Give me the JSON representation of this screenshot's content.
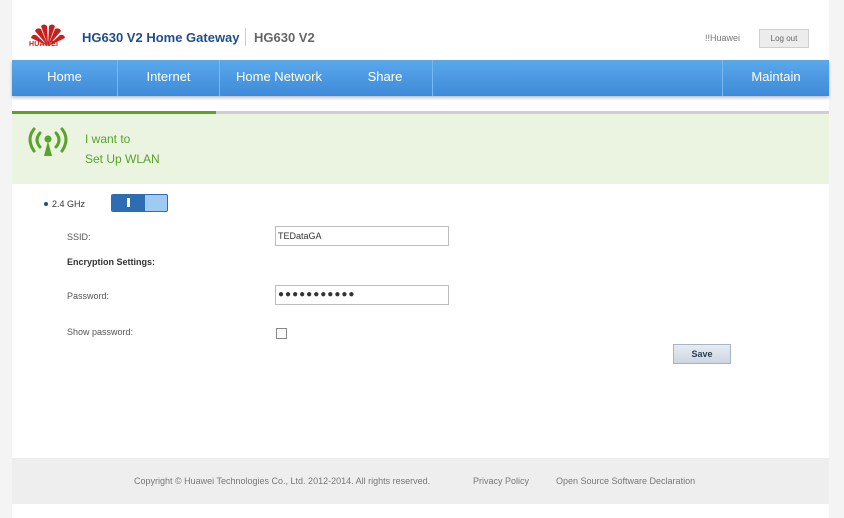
{
  "header": {
    "brand": "HUAWEI",
    "product_title": "HG630 V2 Home Gateway",
    "product_sub": "HG630 V2",
    "user": "!!Huawei",
    "logout_label": "Log out"
  },
  "nav": {
    "items": [
      "Home",
      "Internet",
      "Home Network",
      "Share",
      "Maintain"
    ]
  },
  "wizard": {
    "progress": 0.25,
    "line1": "I want to",
    "line2": "Set Up WLAN"
  },
  "wlan": {
    "band_label": "2.4 GHz",
    "band_enabled": true,
    "ssid_label": "SSID:",
    "ssid_value": "TEDataGA",
    "encryption_heading": "Encryption Settings:",
    "password_label": "Password:",
    "password_value": "●●●●●●●●●●●",
    "show_password_label": "Show password:",
    "show_password_checked": false,
    "save_label": "Save"
  },
  "footer": {
    "copyright": "Copyright © Huawei Technologies Co., Ltd. 2012-2014. All rights reserved.",
    "privacy": "Privacy Policy",
    "oss": "Open Source Software Declaration"
  },
  "colors": {
    "nav_blue": "#4a98e2",
    "accent_green": "#59a22b",
    "brand_red": "#c81e1e",
    "title_blue": "#1e4f8c"
  }
}
